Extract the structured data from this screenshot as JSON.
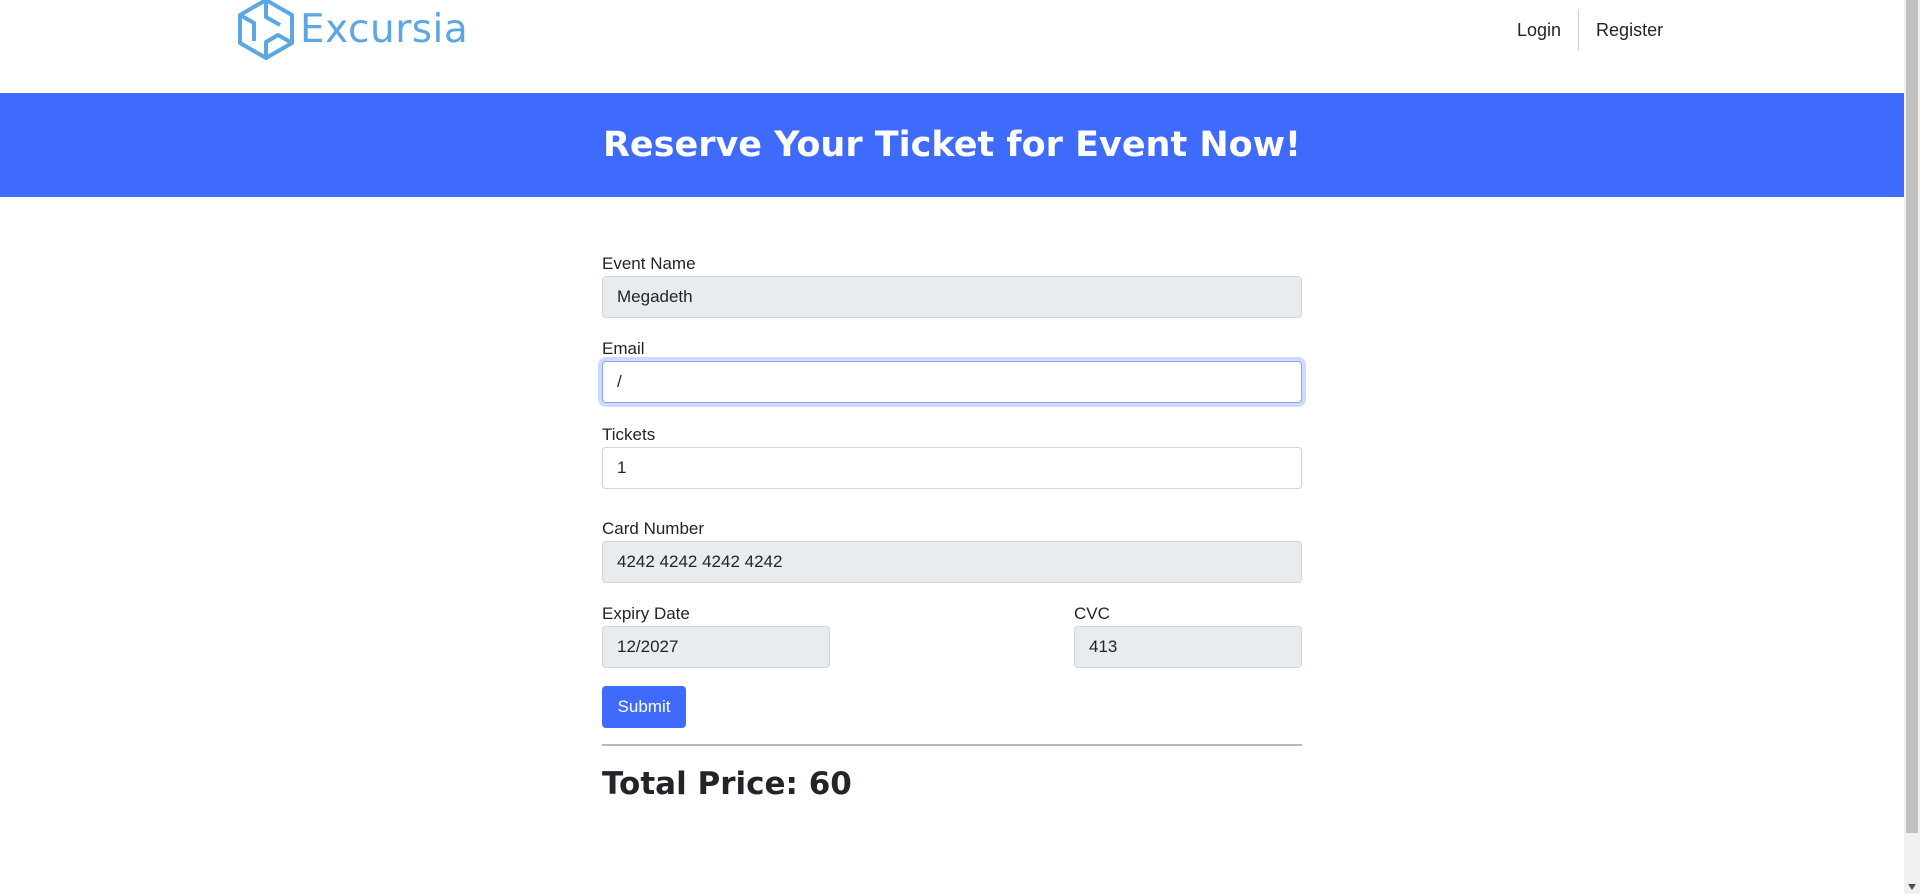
{
  "brand": {
    "name": "Excursia",
    "logo_icon": "hexagon-cube-logo-icon",
    "color": "#5aa7e3"
  },
  "nav": {
    "login": "Login",
    "register": "Register"
  },
  "banner": {
    "title": "Reserve Your Ticket for Event Now!",
    "color": "#3f6bfd"
  },
  "form": {
    "event_name": {
      "label": "Event Name",
      "value": "Megadeth"
    },
    "email": {
      "label": "Email",
      "value": "/"
    },
    "tickets": {
      "label": "Tickets",
      "value": "1"
    },
    "card_number": {
      "label": "Card Number",
      "value": "4242 4242 4242 4242"
    },
    "expiry_date": {
      "label": "Expiry Date",
      "value": "12/2027"
    },
    "cvc": {
      "label": "CVC",
      "value": "413"
    },
    "submit_label": "Submit"
  },
  "total": {
    "text": "Total Price: 60"
  }
}
